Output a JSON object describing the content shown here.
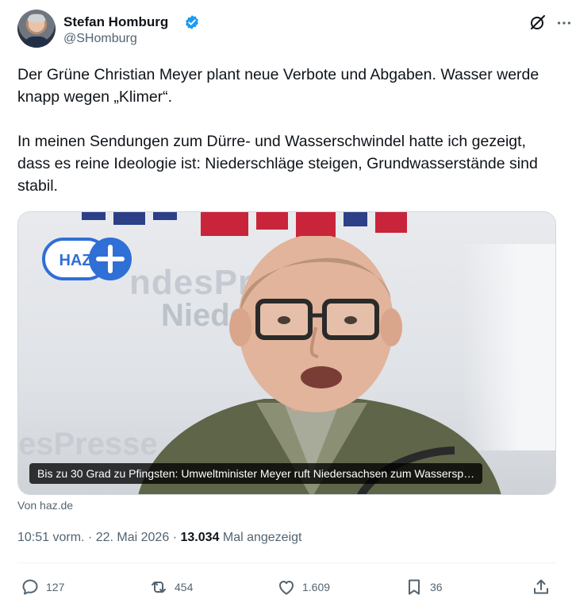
{
  "author": {
    "name": "Stefan Homburg",
    "handle": "@SHomburg",
    "verified": true
  },
  "tweet": {
    "text": "Der Grüne Christian Meyer plant neue Verbote und Abgaben. Wasser werde knapp wegen „Klimer“.\n\nIn meinen Sendungen zum Dürre- und Wasserschwindel hatte ich gezeigt, dass es reine Ideologie ist: Niederschläge steigen, Grundwasserstände sind stabil."
  },
  "card": {
    "logo_text": "HAZ",
    "background_text_1": "ndesPresse",
    "background_text_2": "Niedersach",
    "background_text_3": "esPresse",
    "caption": "Bis zu 30 Grad zu Pfingsten: Umweltminister Meyer ruft Niedersachsen zum Wassersp…",
    "source": "Von haz.de"
  },
  "meta": {
    "time": "10:51 vorm.",
    "separator": "·",
    "date": "22. Mai 2026",
    "views": "13.034",
    "views_label": "Mal angezeigt"
  },
  "actions": {
    "replies": "127",
    "reposts": "454",
    "likes": "1.609",
    "bookmarks": "36"
  },
  "colors": {
    "verified": "#1d9bf0",
    "text": "#0f1419",
    "muted": "#536471",
    "haz_blue": "#2f6fd6"
  },
  "icons": [
    "verified-badge-icon",
    "grok-icon",
    "more-icon",
    "reply-icon",
    "repost-icon",
    "like-icon",
    "bookmark-icon",
    "share-icon"
  ]
}
